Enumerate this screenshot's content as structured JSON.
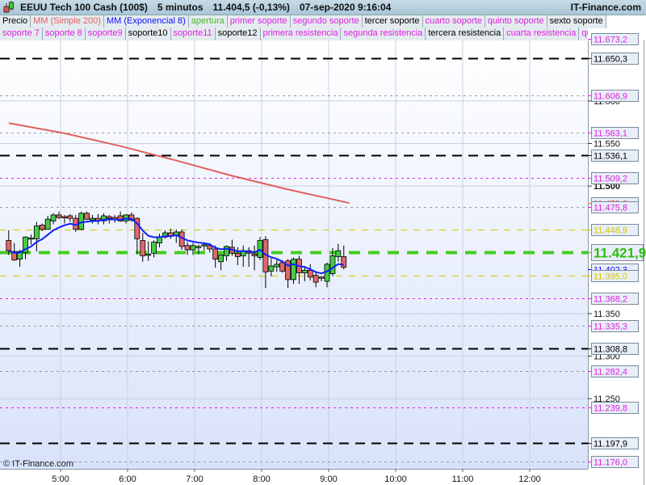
{
  "title": {
    "instrument": "EEUU Tech 100 Cash (100$)",
    "timeframe": "5 minutos",
    "price": "11.404,5 (-0,13%)",
    "datetime": "07-sep-2020 9:16:04",
    "brand": "IT-Finance.com"
  },
  "legend_row1": [
    {
      "label": "Precio",
      "color": "#000000"
    },
    {
      "label": "MM (Simple 200)",
      "color": "#e06060"
    },
    {
      "label": "MM (Exponencial 8)",
      "color": "#1010ff"
    },
    {
      "label": "apertura",
      "color": "#44bb22"
    },
    {
      "label": "primer soporte",
      "color": "#e020e0"
    },
    {
      "label": "segundo soporte",
      "color": "#e020e0"
    },
    {
      "label": "tercer soporte",
      "color": "#000000"
    },
    {
      "label": "cuarto soporte",
      "color": "#e020e0"
    },
    {
      "label": "quinto soporte",
      "color": "#e020e0"
    },
    {
      "label": "sexto soporte",
      "color": "#000000"
    }
  ],
  "legend_row2": [
    {
      "label": "soporte 7",
      "color": "#e020e0"
    },
    {
      "label": "soporte 8",
      "color": "#e020e0"
    },
    {
      "label": "soporte9",
      "color": "#e020e0"
    },
    {
      "label": "soporte10",
      "color": "#000000"
    },
    {
      "label": "soporte11",
      "color": "#e020e0"
    },
    {
      "label": "soporte12",
      "color": "#000000"
    },
    {
      "label": "primera resistencia",
      "color": "#e020e0"
    },
    {
      "label": "segunda resistencia",
      "color": "#e020e0"
    },
    {
      "label": "tercera resistencia",
      "color": "#000000"
    },
    {
      "label": "cuarta resistencia",
      "color": "#e020e0"
    },
    {
      "label": "quinta",
      "color": "#e020e0"
    }
  ],
  "copyright": "© IT-Finance.com",
  "chart_data": {
    "type": "candlestick",
    "y_range": [
      11170,
      11695
    ],
    "price_ticks": [
      "11.600",
      "11.550",
      "11.500",
      "11.350",
      "11.300",
      "11.250"
    ],
    "price_tick_values": [
      11600,
      11550,
      11500,
      11350,
      11300,
      11250
    ],
    "time_ticks": [
      "5:00",
      "6:00",
      "7:00",
      "8:00",
      "9:00",
      "10:00",
      "11:00",
      "12:00"
    ],
    "first_candle_time_hours": 4.25,
    "candle_minutes": 5,
    "candles": [
      [
        11436,
        11448,
        11419,
        11424
      ],
      [
        11423,
        11433,
        11412,
        11413
      ],
      [
        11414,
        11425,
        11405,
        11423
      ],
      [
        11422,
        11441,
        11414,
        11440
      ],
      [
        11438,
        11443,
        11431,
        11439
      ],
      [
        11438,
        11458,
        11423,
        11453
      ],
      [
        11454,
        11456,
        11447,
        11449
      ],
      [
        11449,
        11465,
        11449,
        11461
      ],
      [
        11459,
        11468,
        11455,
        11466
      ],
      [
        11466,
        11470,
        11461,
        11463
      ],
      [
        11464,
        11466,
        11456,
        11463
      ],
      [
        11465,
        11467,
        11458,
        11462
      ],
      [
        11462,
        11466,
        11446,
        11449
      ],
      [
        11449,
        11470,
        11448,
        11468
      ],
      [
        11468,
        11470,
        11460,
        11461
      ],
      [
        11460,
        11466,
        11456,
        11462
      ],
      [
        11462,
        11467,
        11455,
        11459
      ],
      [
        11459,
        11468,
        11455,
        11465
      ],
      [
        11464,
        11466,
        11456,
        11462
      ],
      [
        11463,
        11466,
        11457,
        11461
      ],
      [
        11465,
        11470,
        11458,
        11459
      ],
      [
        11459,
        11467,
        11456,
        11466
      ],
      [
        11466,
        11469,
        11458,
        11460
      ],
      [
        11462,
        11463,
        11420,
        11438
      ],
      [
        11436,
        11445,
        11411,
        11418
      ],
      [
        11420,
        11435,
        11412,
        11420
      ],
      [
        11421,
        11436,
        11416,
        11434
      ],
      [
        11433,
        11444,
        11428,
        11440
      ],
      [
        11440,
        11448,
        11438,
        11445
      ],
      [
        11445,
        11450,
        11438,
        11441
      ],
      [
        11442,
        11449,
        11433,
        11446
      ],
      [
        11446,
        11449,
        11425,
        11429
      ],
      [
        11430,
        11434,
        11419,
        11425
      ],
      [
        11425,
        11433,
        11419,
        11430
      ],
      [
        11429,
        11431,
        11420,
        11429
      ],
      [
        11430,
        11433,
        11424,
        11431
      ],
      [
        11430,
        11433,
        11422,
        11426
      ],
      [
        11426,
        11430,
        11404,
        11414
      ],
      [
        11411,
        11420,
        11401,
        11419
      ],
      [
        11418,
        11430,
        11412,
        11429
      ],
      [
        11428,
        11437,
        11418,
        11421
      ],
      [
        11421,
        11428,
        11407,
        11417
      ],
      [
        11418,
        11430,
        11405,
        11424
      ],
      [
        11424,
        11428,
        11405,
        11421
      ],
      [
        11420,
        11430,
        11401,
        11418
      ],
      [
        11416,
        11440,
        11413,
        11436
      ],
      [
        11437,
        11441,
        11380,
        11399
      ],
      [
        11400,
        11415,
        11394,
        11406
      ],
      [
        11405,
        11413,
        11399,
        11408
      ],
      [
        11410,
        11413,
        11398,
        11400
      ],
      [
        11412,
        11414,
        11380,
        11390
      ],
      [
        11390,
        11416,
        11385,
        11414
      ],
      [
        11414,
        11418,
        11385,
        11398
      ],
      [
        11398,
        11406,
        11388,
        11401
      ],
      [
        11401,
        11408,
        11389,
        11393
      ],
      [
        11395,
        11400,
        11381,
        11387
      ],
      [
        11393,
        11394,
        11388,
        11392
      ],
      [
        11388,
        11410,
        11381,
        11408
      ],
      [
        11397,
        11427,
        11394,
        11418
      ],
      [
        11417,
        11432,
        11411,
        11424
      ],
      [
        11417,
        11430,
        11402,
        11404.5
      ]
    ],
    "sma200": [
      [
        0,
        11574
      ],
      [
        10,
        11562
      ],
      [
        20,
        11547
      ],
      [
        30,
        11530
      ],
      [
        40,
        11512
      ],
      [
        50,
        11496
      ],
      [
        61,
        11480
      ]
    ],
    "ema8_period": 8,
    "levels": [
      {
        "label": "11.673,2",
        "value": 11673.2,
        "color": "#e020e0",
        "line": "#e020e0",
        "style": "dot"
      },
      {
        "label": "11.650,3",
        "value": 11650.3,
        "color": "#000000",
        "line": "#000000",
        "style": "long"
      },
      {
        "label": "11.606,9",
        "value": 11606.9,
        "color": "#e020e0",
        "line": "#888888",
        "style": "dot"
      },
      {
        "label": "11.563,1",
        "value": 11563.1,
        "color": "#e020e0",
        "line": "#888888",
        "style": "dot"
      },
      {
        "label": "11.536,1",
        "value": 11536.1,
        "color": "#000000",
        "line": "#000000",
        "style": "long"
      },
      {
        "label": "11.509,2",
        "value": 11509.2,
        "color": "#e020e0",
        "line": "#e020e0",
        "style": "dot"
      },
      {
        "label": "11.479,8",
        "value": 11479.8,
        "color": "#e06060",
        "line": "none",
        "style": "none"
      },
      {
        "label": "11.475,8",
        "value": 11475.8,
        "color": "#e020e0",
        "line": "#888888",
        "style": "dot"
      },
      {
        "label": "11.448,9",
        "value": 11448.9,
        "color": "#d4c800",
        "line": "#d4c800",
        "style": "dash"
      },
      {
        "label": "11.421,9",
        "value": 11421.9,
        "color": "#33bb11",
        "line": "#44cc22",
        "style": "thick",
        "big": true
      },
      {
        "label": "11.402,3",
        "value": 11402.3,
        "color": "#1010ff",
        "line": "none",
        "style": "none"
      },
      {
        "label": "11.395,0",
        "value": 11395.0,
        "color": "#d4c800",
        "line": "#d4c800",
        "style": "dash"
      },
      {
        "label": "11.368,2",
        "value": 11368.2,
        "color": "#e020e0",
        "line": "#e020e0",
        "style": "dot"
      },
      {
        "label": "11.335,3",
        "value": 11335.3,
        "color": "#e020e0",
        "line": "#888888",
        "style": "dot"
      },
      {
        "label": "11.308,8",
        "value": 11308.8,
        "color": "#000000",
        "line": "#000000",
        "style": "long"
      },
      {
        "label": "11.282,4",
        "value": 11282.4,
        "color": "#e020e0",
        "line": "#888888",
        "style": "dot"
      },
      {
        "label": "11.239,8",
        "value": 11239.8,
        "color": "#e020e0",
        "line": "#e020e0",
        "style": "dot"
      },
      {
        "label": "11.197,9",
        "value": 11197.9,
        "color": "#000000",
        "line": "#000000",
        "style": "long"
      },
      {
        "label": "11.176,0",
        "value": 11176.0,
        "color": "#e020e0",
        "line": "#888888",
        "style": "dot"
      }
    ]
  }
}
